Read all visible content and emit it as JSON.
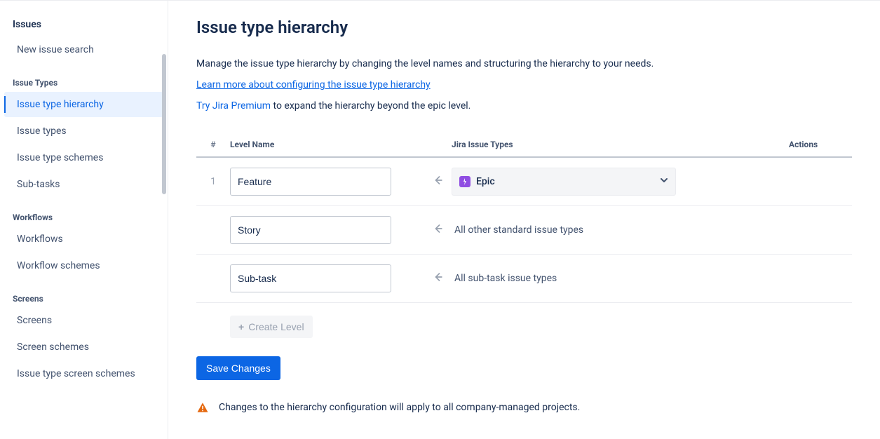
{
  "sidebar": {
    "title": "Issues",
    "quick": {
      "label": "New issue search"
    },
    "sections": [
      {
        "title": "Issue Types",
        "items": [
          {
            "label": "Issue type hierarchy",
            "active": true
          },
          {
            "label": "Issue types",
            "active": false
          },
          {
            "label": "Issue type schemes",
            "active": false
          },
          {
            "label": "Sub-tasks",
            "active": false
          }
        ]
      },
      {
        "title": "Workflows",
        "items": [
          {
            "label": "Workflows",
            "active": false
          },
          {
            "label": "Workflow schemes",
            "active": false
          }
        ]
      },
      {
        "title": "Screens",
        "items": [
          {
            "label": "Screens",
            "active": false
          },
          {
            "label": "Screen schemes",
            "active": false
          },
          {
            "label": "Issue type screen schemes",
            "active": false
          }
        ]
      }
    ]
  },
  "main": {
    "title": "Issue type hierarchy",
    "intro": "Manage the issue type hierarchy by changing the level names and structuring the hierarchy to your needs.",
    "learn_more_link": "Learn more about configuring the issue type hierarchy",
    "premium_link": "Try Jira Premium",
    "premium_rest": " to expand the hierarchy beyond the epic level.",
    "table": {
      "headers": {
        "index": "#",
        "name": "Level Name",
        "types": "Jira Issue Types",
        "actions": "Actions"
      },
      "rows": [
        {
          "index": "1",
          "name": "Feature",
          "type_kind": "select",
          "type_label": "Epic",
          "type_icon": "epic"
        },
        {
          "index": "",
          "name": "Story",
          "type_kind": "static",
          "type_label": "All other standard issue types"
        },
        {
          "index": "",
          "name": "Sub-task",
          "type_kind": "static",
          "type_label": "All sub-task issue types"
        }
      ],
      "create_level_label": "Create Level"
    },
    "save_label": "Save Changes",
    "warning_text": "Changes to the hierarchy configuration will apply to all company-managed projects."
  }
}
